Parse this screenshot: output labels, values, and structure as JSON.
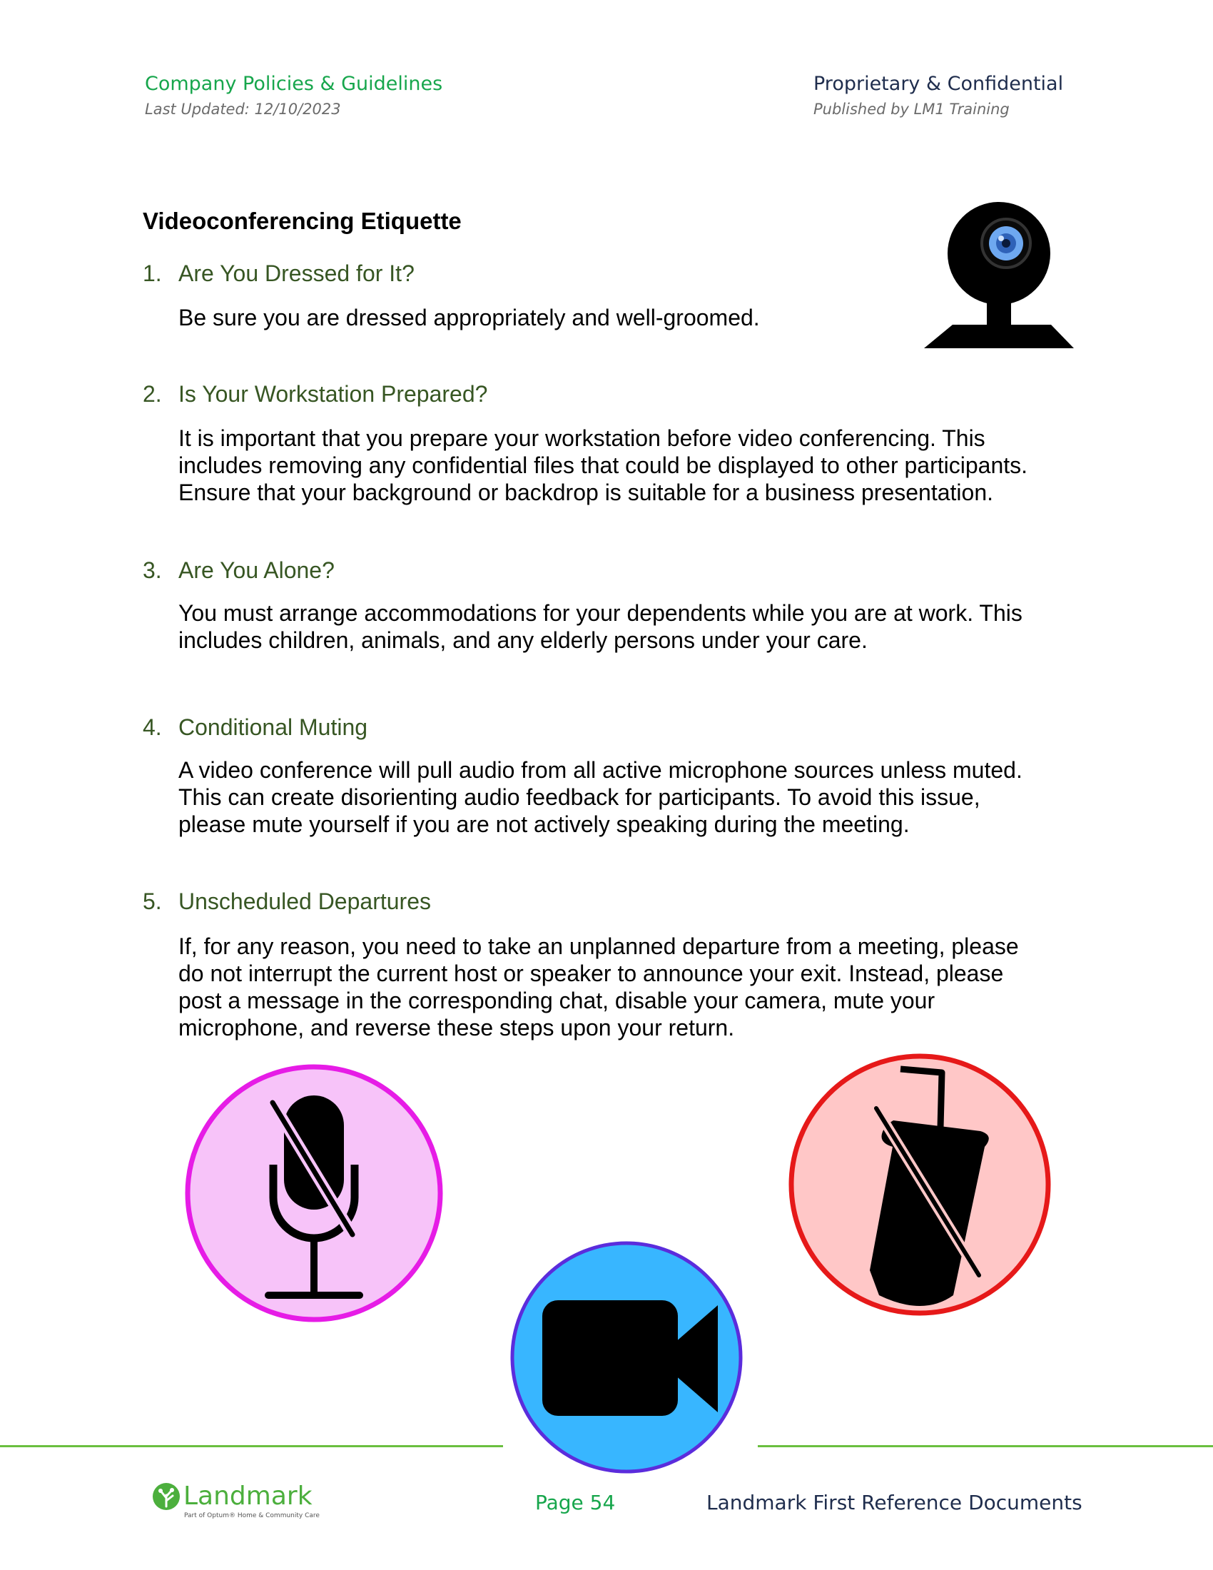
{
  "header": {
    "left_title": "Company Policies & Guidelines",
    "left_subtitle": "Last Updated: 12/10/2023",
    "right_title": "Proprietary & Confidential",
    "right_subtitle": "Published by LM1 Training"
  },
  "document": {
    "title": "Videoconferencing Etiquette",
    "items": [
      {
        "number": "1.",
        "heading": "Are You Dressed for It?",
        "lines": [
          "Be sure you are dressed appropriately and well-groomed."
        ]
      },
      {
        "number": "2.",
        "heading": "Is Your Workstation Prepared?",
        "lines": [
          "It is important that you prepare your workstation before video conferencing. This",
          "includes removing any confidential files that could be displayed to other participants.",
          "Ensure that your background or backdrop is suitable for a business presentation."
        ]
      },
      {
        "number": "3.",
        "heading": "Are You Alone?",
        "lines": [
          "You must arrange accommodations for your dependents while you are at work. This",
          "includes children, animals, and any elderly persons under your care."
        ]
      },
      {
        "number": "4.",
        "heading": "Conditional Muting",
        "lines": [
          "A video conference will pull audio from all active microphone sources unless muted.",
          "This can create disorienting audio feedback for participants. To avoid this issue,",
          "please mute yourself if you are not actively speaking during the meeting."
        ]
      },
      {
        "number": "5.",
        "heading": "Unscheduled Departures",
        "lines": [
          "If, for any reason, you need to take an unplanned departure from a meeting, please",
          "do not interrupt the current host or speaker to announce your exit. Instead, please",
          "post a message in the corresponding chat, disable your camera, mute your",
          "microphone, and reverse these steps upon your return."
        ]
      }
    ]
  },
  "icons": {
    "webcam": "webcam-icon",
    "muted_mic": "muted-microphone-icon",
    "video_camera": "video-camera-icon",
    "no_drink": "no-drinks-icon"
  },
  "colors": {
    "header_green": "#17a64c",
    "header_navy": "#1f2d4d",
    "heading_green": "#375623",
    "footer_rule": "#6abf3f",
    "mic_circle_fill": "#f7c3f9",
    "mic_circle_stroke": "#e61ce6",
    "video_circle_fill": "#38b6ff",
    "video_circle_stroke": "#5b2cdc",
    "drink_circle_fill": "#ffc7c7",
    "drink_circle_stroke": "#e61919"
  },
  "footer": {
    "logo_text": "Landmark",
    "logo_tagline": "Part of Optum® Home & Community Care",
    "page_label": "Page 54",
    "reference": "Landmark First Reference Documents"
  }
}
